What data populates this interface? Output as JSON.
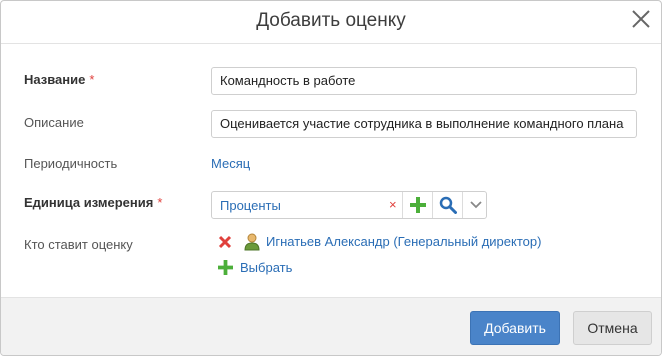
{
  "dialog": {
    "title": "Добавить оценку",
    "close_icon": "close-icon"
  },
  "form": {
    "name": {
      "label": "Название",
      "required_mark": "*",
      "value": "Командность в работе"
    },
    "description": {
      "label": "Описание",
      "value": "Оценивается участие сотрудника в выполнение командного плана"
    },
    "periodicity": {
      "label": "Периодичность",
      "value": "Месяц"
    },
    "unit": {
      "label": "Единица измерения",
      "required_mark": "*",
      "value": "Проценты",
      "clear_mark": "×"
    },
    "evaluator": {
      "label": "Кто ставит оценку",
      "person": "Игнатьев Александр (Генеральный директор)",
      "choose_label": "Выбрать"
    }
  },
  "footer": {
    "add_label": "Добавить",
    "cancel_label": "Отмена"
  },
  "colors": {
    "accent": "#4a84c9",
    "link": "#2a6db5",
    "required": "#e0403c",
    "add_green": "#4caf3a"
  }
}
